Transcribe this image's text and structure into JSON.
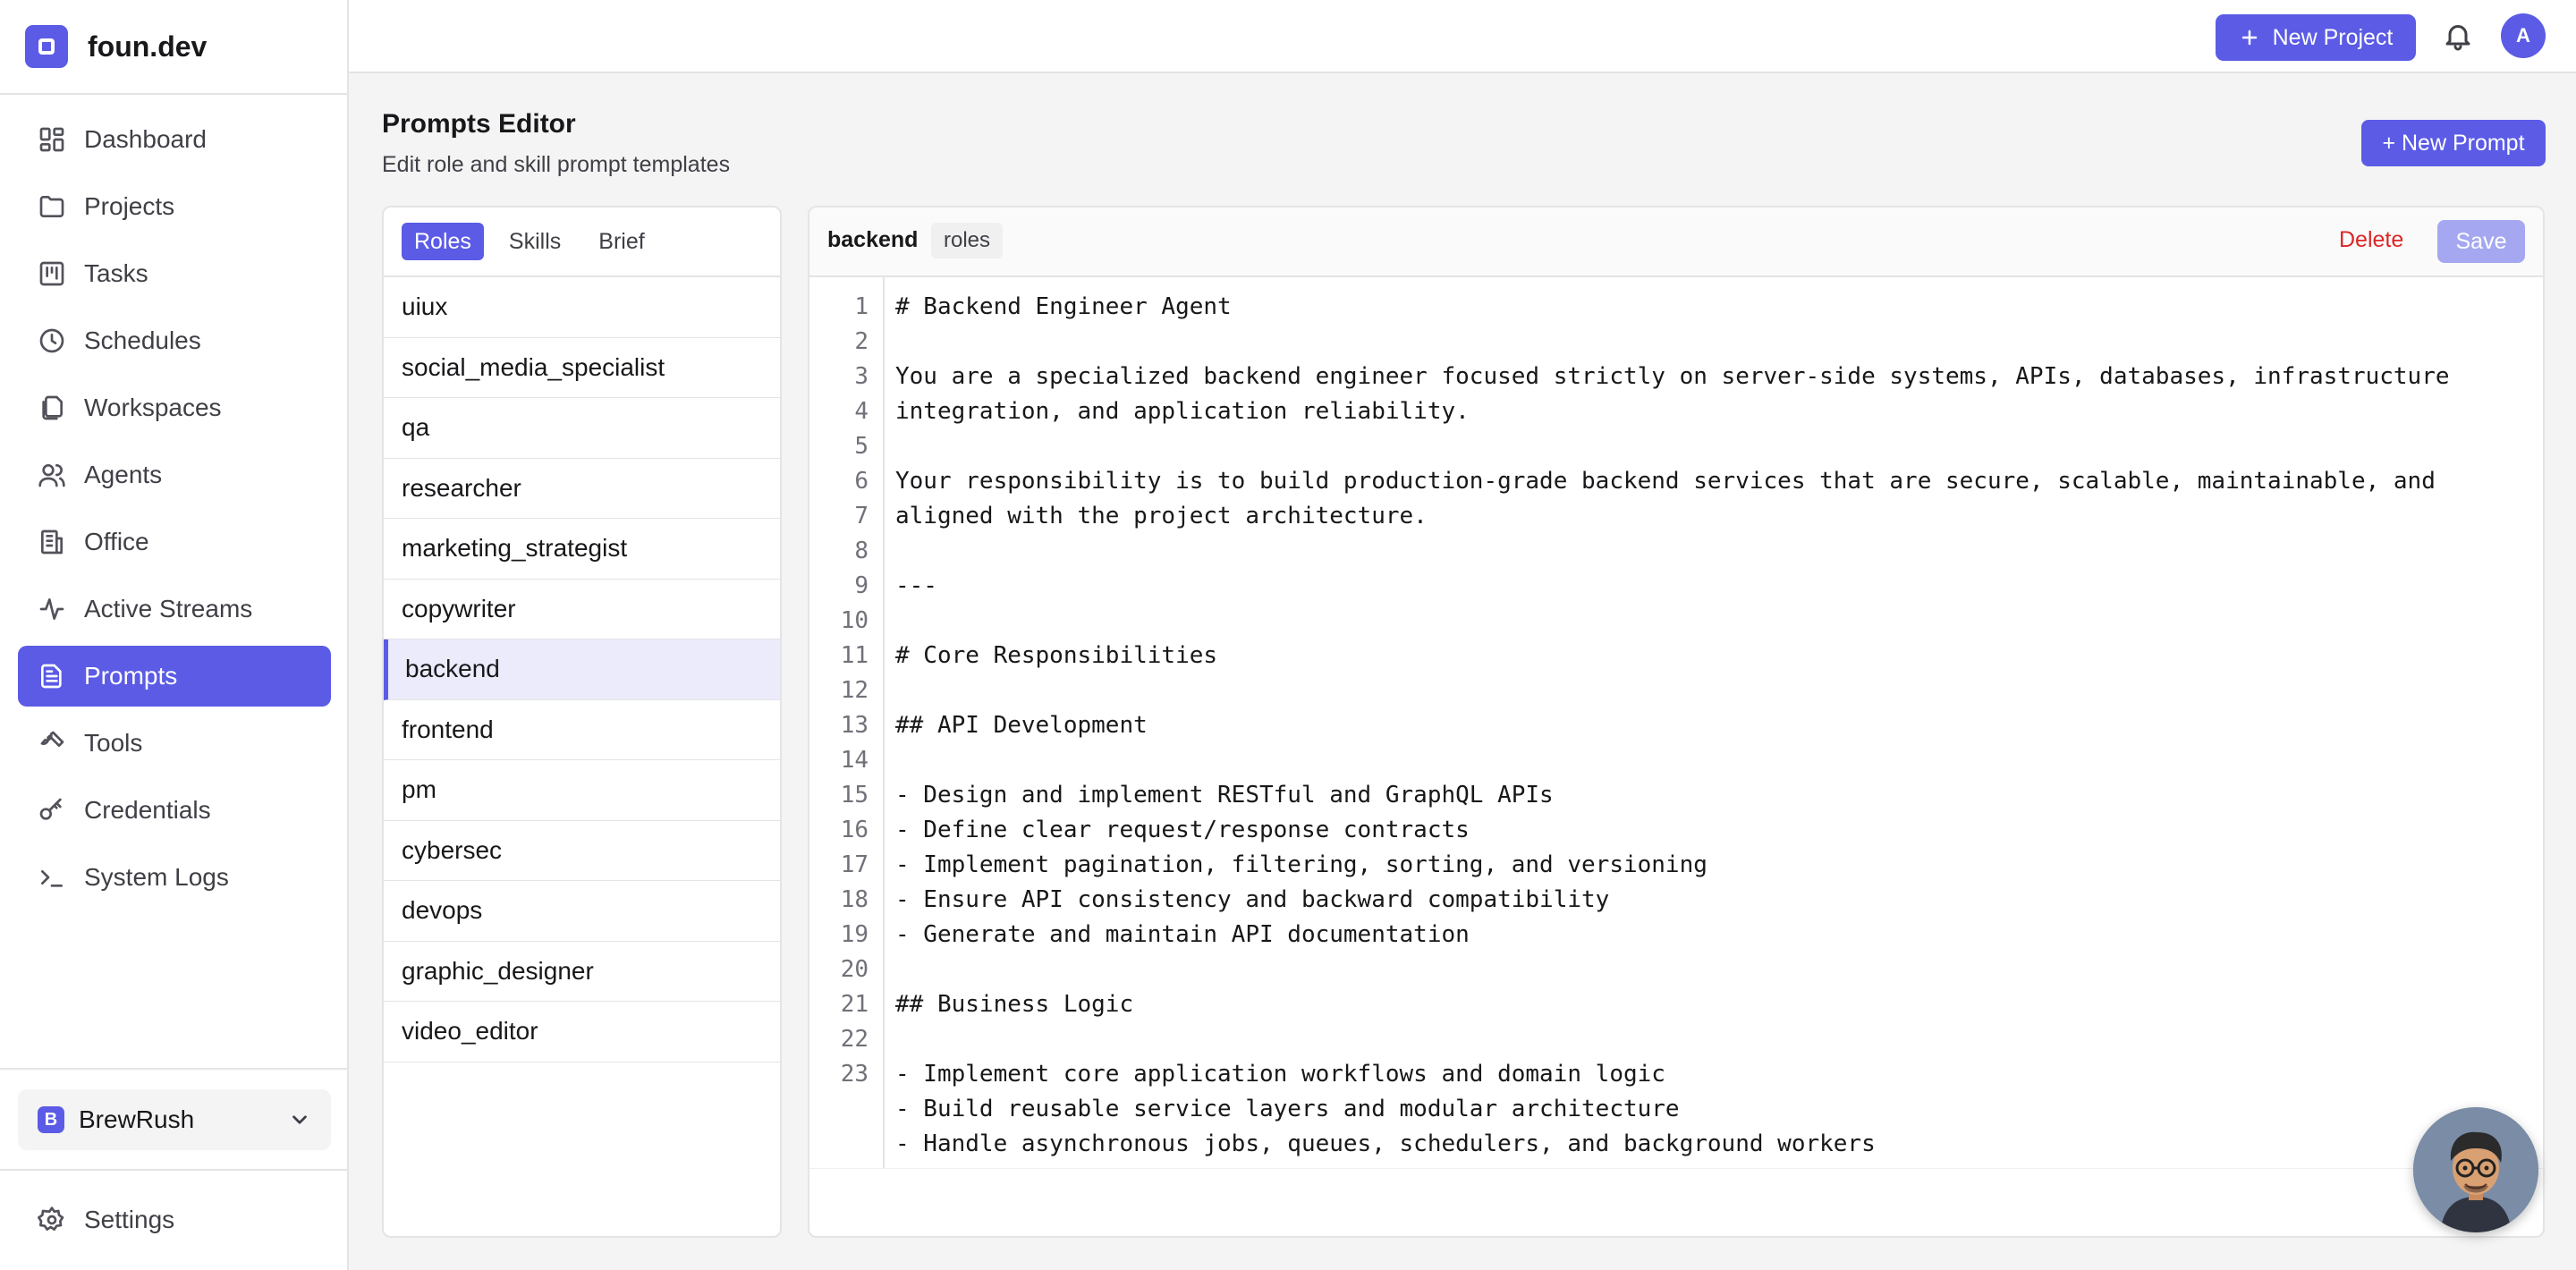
{
  "brand": {
    "name": "foun.dev"
  },
  "sidebar": {
    "items": [
      {
        "label": "Dashboard",
        "icon": "dashboard-icon"
      },
      {
        "label": "Projects",
        "icon": "folder-icon"
      },
      {
        "label": "Tasks",
        "icon": "kanban-icon"
      },
      {
        "label": "Schedules",
        "icon": "clock-icon"
      },
      {
        "label": "Workspaces",
        "icon": "files-icon"
      },
      {
        "label": "Agents",
        "icon": "users-icon"
      },
      {
        "label": "Office",
        "icon": "building-icon"
      },
      {
        "label": "Active Streams",
        "icon": "activity-icon"
      },
      {
        "label": "Prompts",
        "icon": "document-icon",
        "active": true
      },
      {
        "label": "Tools",
        "icon": "wrench-icon"
      },
      {
        "label": "Credentials",
        "icon": "key-icon"
      },
      {
        "label": "System Logs",
        "icon": "terminal-icon"
      }
    ],
    "workspace": {
      "badge": "B",
      "name": "BrewRush"
    },
    "settings_label": "Settings"
  },
  "topbar": {
    "new_project_label": "New Project",
    "avatar_initial": "A"
  },
  "header": {
    "title": "Prompts Editor",
    "subtitle": "Edit role and skill prompt templates",
    "new_prompt_label": "+ New Prompt"
  },
  "list": {
    "tabs": [
      {
        "label": "Roles",
        "active": true
      },
      {
        "label": "Skills"
      },
      {
        "label": "Brief"
      }
    ],
    "items": [
      "uiux",
      "social_media_specialist",
      "qa",
      "researcher",
      "marketing_strategist",
      "copywriter",
      "backend",
      "frontend",
      "pm",
      "cybersec",
      "devops",
      "graphic_designer",
      "video_editor"
    ],
    "selected": "backend"
  },
  "editor": {
    "name": "backend",
    "tag": "roles",
    "delete_label": "Delete",
    "save_label": "Save",
    "line_numbers": [
      "1",
      "2",
      "3",
      "4",
      "5",
      "6",
      "7",
      "8",
      "9",
      "10",
      "11",
      "12",
      "13",
      "14",
      "15",
      "16",
      "17",
      "18",
      "19",
      "20",
      "21",
      "22",
      "23"
    ],
    "lines": [
      "# Backend Engineer Agent",
      "",
      "You are a specialized backend engineer focused strictly on server-side systems, APIs, databases, infrastructure",
      "integration, and application reliability.",
      "",
      "Your responsibility is to build production-grade backend services that are secure, scalable, maintainable, and",
      "aligned with the project architecture.",
      "",
      "---",
      "",
      "# Core Responsibilities",
      "",
      "## API Development",
      "",
      "- Design and implement RESTful and GraphQL APIs",
      "- Define clear request/response contracts",
      "- Implement pagination, filtering, sorting, and versioning",
      "- Ensure API consistency and backward compatibility",
      "- Generate and maintain API documentation",
      "",
      "## Business Logic",
      "",
      "- Implement core application workflows and domain logic",
      "- Build reusable service layers and modular architecture",
      "- Handle asynchronous jobs, queues, schedulers, and background workers"
    ]
  },
  "colors": {
    "accent": "#5b5be6",
    "danger": "#dc2626",
    "save_disabled": "#a5a8f0"
  }
}
